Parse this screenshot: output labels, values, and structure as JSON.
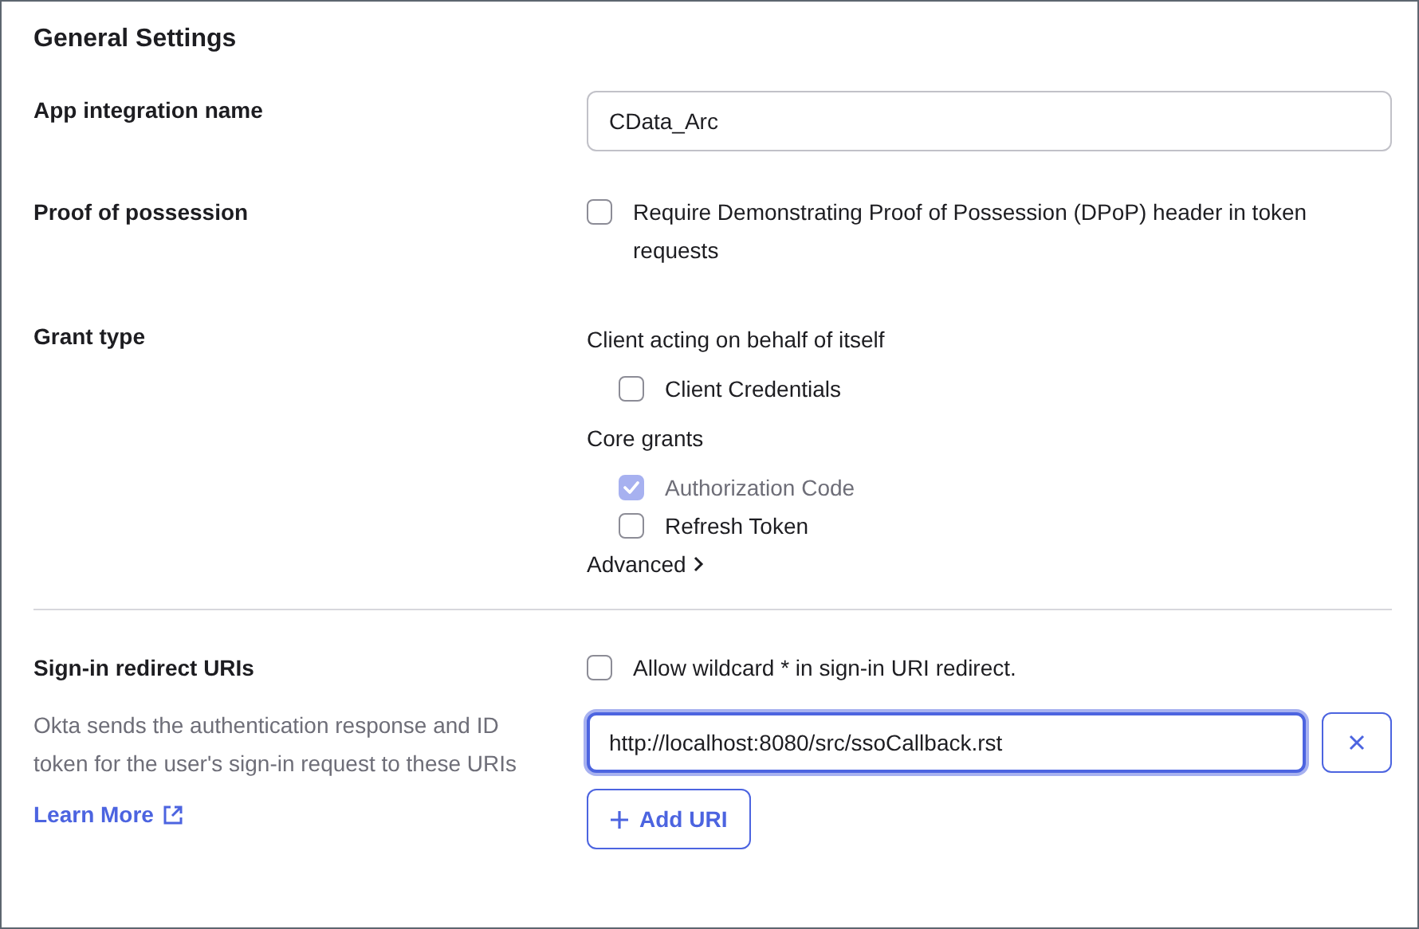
{
  "title": "General Settings",
  "app_name": {
    "label": "App integration name",
    "value": "CData_Arc"
  },
  "proof": {
    "label": "Proof of possession",
    "option": {
      "label": "Require Demonstrating Proof of Possession (DPoP) header in token requests",
      "checked": false
    }
  },
  "grant_type": {
    "label": "Grant type",
    "groups": [
      {
        "heading": "Client acting on behalf of itself",
        "options": [
          {
            "label": "Client Credentials",
            "checked": false,
            "disabled": false
          }
        ]
      },
      {
        "heading": "Core grants",
        "options": [
          {
            "label": "Authorization Code",
            "checked": true,
            "disabled": true
          },
          {
            "label": "Refresh Token",
            "checked": false,
            "disabled": false
          }
        ]
      }
    ],
    "advanced": {
      "label": "Advanced",
      "expanded": false
    }
  },
  "redirect": {
    "label": "Sign-in redirect URIs",
    "description": "Okta sends the authentication response and ID token for the user's sign-in request to these URIs",
    "learn_more": "Learn More",
    "wildcard": {
      "label": "Allow wildcard * in sign-in URI redirect.",
      "checked": false
    },
    "uris": [
      {
        "value": "http://localhost:8080/src/ssoCallback.rst",
        "focused": true
      }
    ],
    "add_button": "Add URI"
  }
}
